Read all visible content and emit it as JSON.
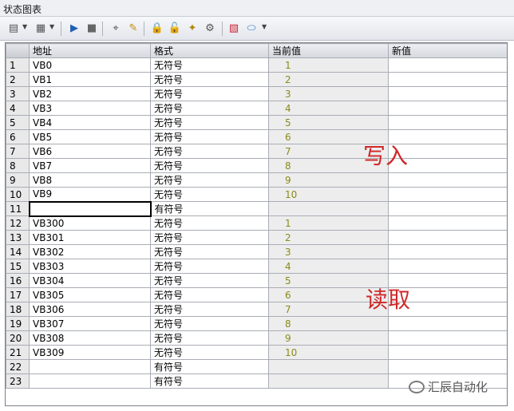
{
  "window": {
    "title": "状态图表"
  },
  "toolbar": {
    "icons": [
      "insert-icon",
      "delete-icon",
      "run-icon",
      "stop-icon",
      "scan-icon",
      "pencil-icon",
      "lock-icon",
      "unlock-icon",
      "unlock-all-icon",
      "read-all-icon",
      "trend-icon",
      "tag-icon"
    ]
  },
  "table": {
    "headers": {
      "addr": "地址",
      "fmt": "格式",
      "cur": "当前值",
      "new": "新值"
    },
    "rows": [
      {
        "num": "1",
        "addr": "VB0",
        "fmt": "无符号",
        "cur": "1",
        "new": ""
      },
      {
        "num": "2",
        "addr": "VB1",
        "fmt": "无符号",
        "cur": "2",
        "new": ""
      },
      {
        "num": "3",
        "addr": "VB2",
        "fmt": "无符号",
        "cur": "3",
        "new": ""
      },
      {
        "num": "4",
        "addr": "VB3",
        "fmt": "无符号",
        "cur": "4",
        "new": ""
      },
      {
        "num": "5",
        "addr": "VB4",
        "fmt": "无符号",
        "cur": "5",
        "new": ""
      },
      {
        "num": "6",
        "addr": "VB5",
        "fmt": "无符号",
        "cur": "6",
        "new": ""
      },
      {
        "num": "7",
        "addr": "VB6",
        "fmt": "无符号",
        "cur": "7",
        "new": ""
      },
      {
        "num": "8",
        "addr": "VB7",
        "fmt": "无符号",
        "cur": "8",
        "new": ""
      },
      {
        "num": "9",
        "addr": "VB8",
        "fmt": "无符号",
        "cur": "9",
        "new": ""
      },
      {
        "num": "10",
        "addr": "VB9",
        "fmt": "无符号",
        "cur": "10",
        "new": ""
      },
      {
        "num": "11",
        "addr": "",
        "fmt": "有符号",
        "cur": "",
        "new": ""
      },
      {
        "num": "12",
        "addr": "VB300",
        "fmt": "无符号",
        "cur": "1",
        "new": ""
      },
      {
        "num": "13",
        "addr": "VB301",
        "fmt": "无符号",
        "cur": "2",
        "new": ""
      },
      {
        "num": "14",
        "addr": "VB302",
        "fmt": "无符号",
        "cur": "3",
        "new": ""
      },
      {
        "num": "15",
        "addr": "VB303",
        "fmt": "无符号",
        "cur": "4",
        "new": ""
      },
      {
        "num": "16",
        "addr": "VB304",
        "fmt": "无符号",
        "cur": "5",
        "new": ""
      },
      {
        "num": "17",
        "addr": "VB305",
        "fmt": "无符号",
        "cur": "6",
        "new": ""
      },
      {
        "num": "18",
        "addr": "VB306",
        "fmt": "无符号",
        "cur": "7",
        "new": ""
      },
      {
        "num": "19",
        "addr": "VB307",
        "fmt": "无符号",
        "cur": "8",
        "new": ""
      },
      {
        "num": "20",
        "addr": "VB308",
        "fmt": "无符号",
        "cur": "9",
        "new": ""
      },
      {
        "num": "21",
        "addr": "VB309",
        "fmt": "无符号",
        "cur": "10",
        "new": ""
      },
      {
        "num": "22",
        "addr": "",
        "fmt": "有符号",
        "cur": "",
        "new": ""
      },
      {
        "num": "23",
        "addr": "",
        "fmt": "有符号",
        "cur": "",
        "new": ""
      }
    ]
  },
  "annotations": {
    "write": "写入",
    "read": "读取"
  },
  "watermark": {
    "text": "汇辰自动化"
  },
  "colors": {
    "annotation": "#d02828",
    "value_text": "#8a8a18"
  }
}
